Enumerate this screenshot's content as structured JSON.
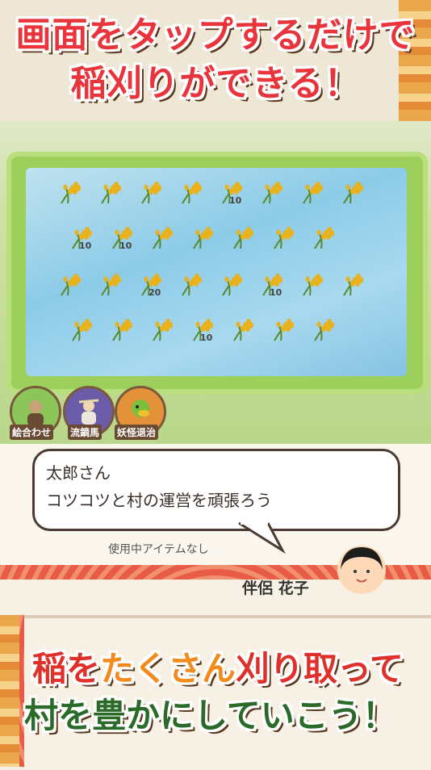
{
  "banner_top": {
    "line1": "画面をタップするだけで",
    "line2": "稲刈りができる！"
  },
  "rice_field": {
    "rows": [
      [
        null,
        null,
        null,
        null,
        "10",
        null,
        null,
        null
      ],
      [
        "10",
        "10",
        null,
        null,
        null,
        null,
        null
      ],
      [
        null,
        null,
        "20",
        null,
        null,
        "10",
        null,
        null
      ],
      [
        null,
        null,
        null,
        "10",
        null,
        null,
        null
      ]
    ],
    "icon": "rice-plant-icon"
  },
  "actions": [
    {
      "label": "絵合わせ",
      "icon": "monk-icon",
      "color": "#8cc55a"
    },
    {
      "label": "流鏑馬",
      "icon": "archer-icon",
      "color": "#6a5ca8"
    },
    {
      "label": "妖怪退治",
      "icon": "kappa-icon",
      "color": "#e3923a"
    }
  ],
  "dialog": {
    "speaker": "太郎さん",
    "message": "コツコツと村の運営を頑張ろう",
    "item_status": "使用中アイテムなし",
    "npc_name": "伴侶 花子"
  },
  "banner_bottom": {
    "line1_a": "稲を",
    "line1_b": "たくさん",
    "line1_c": "刈り取って",
    "line2": "村を豊かにしていこう！"
  }
}
